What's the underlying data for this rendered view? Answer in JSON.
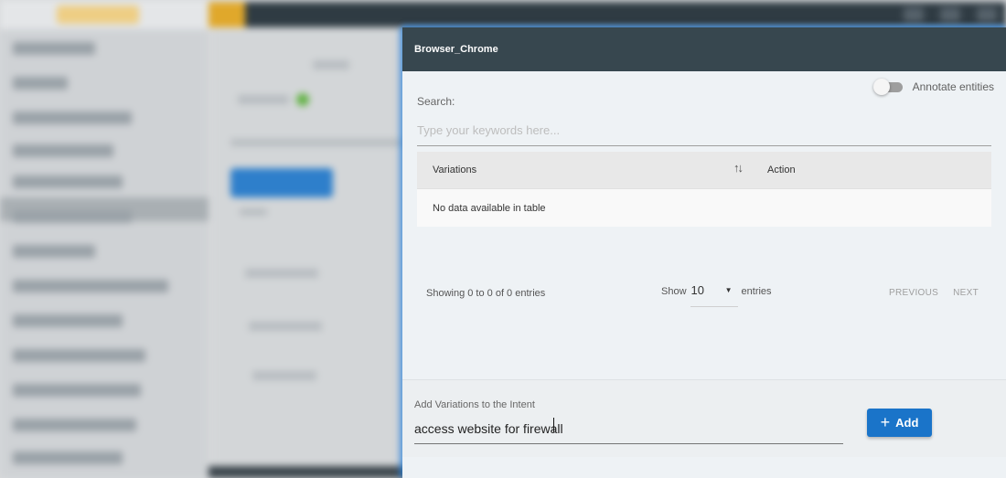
{
  "modal": {
    "title": "Browser_Chrome",
    "annotate_toggle": {
      "label": "Annotate entities",
      "enabled": false
    },
    "search": {
      "label": "Search:",
      "placeholder": "Type your keywords here...",
      "value": ""
    },
    "table": {
      "columns": [
        "Variations",
        "Action"
      ],
      "empty_message": "No data available in table"
    },
    "table_info": "Showing 0 to 0 of 0 entries",
    "page_length": {
      "prefix": "Show",
      "value": "10",
      "suffix": "entries"
    },
    "pagination": {
      "previous": "PREVIOUS",
      "next": "NEXT"
    },
    "add_variation": {
      "label": "Add Variations to the Intent",
      "value": "access website for firewall",
      "button_label": "Add"
    }
  },
  "icons": {
    "sort": "sort-icon",
    "dropdown": "caret-down-icon",
    "add": "plus-icon"
  },
  "colors": {
    "header_bg": "#37474f",
    "accent_blue": "#1a74c9"
  }
}
